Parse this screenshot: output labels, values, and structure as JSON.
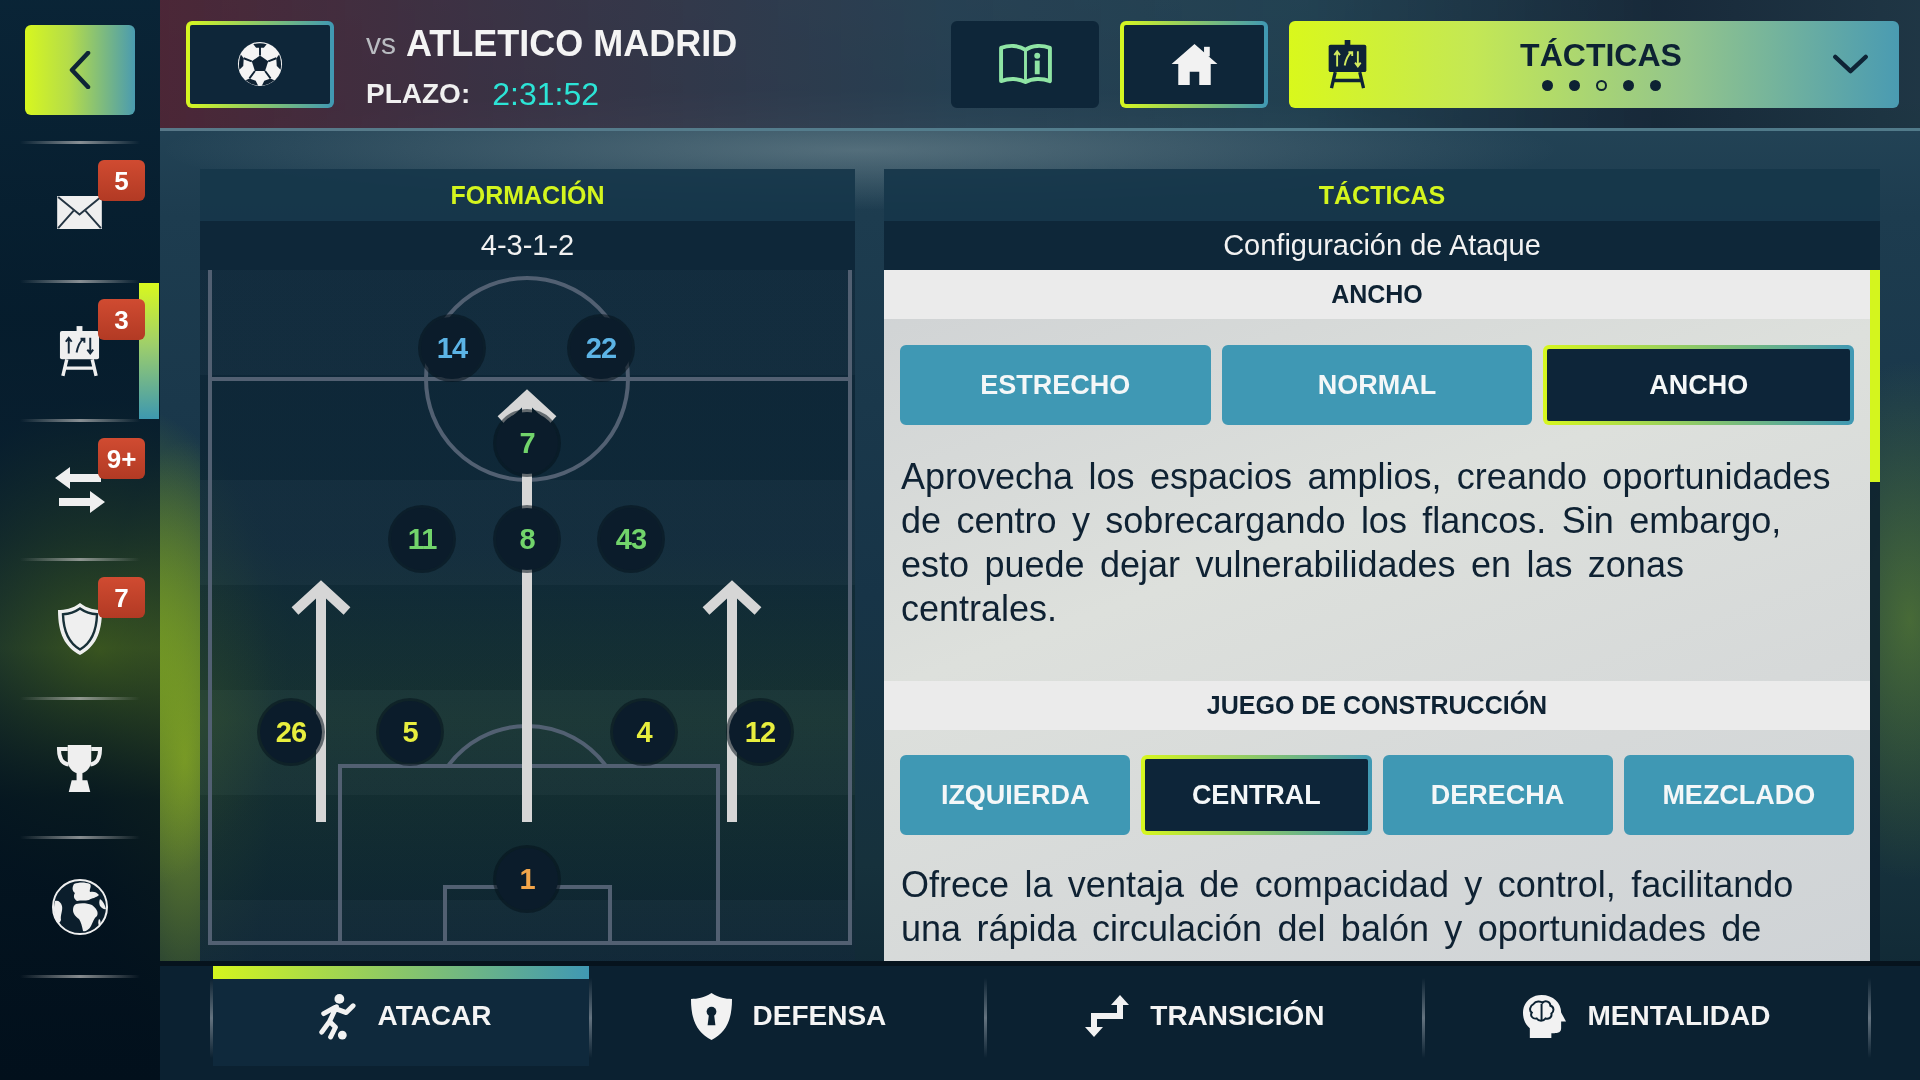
{
  "sidebar": {
    "items": [
      {
        "badge": "5",
        "selected": false
      },
      {
        "badge": "3",
        "selected": true
      },
      {
        "badge": "9+",
        "selected": false
      },
      {
        "badge": "7",
        "selected": false
      },
      {
        "selected": false
      },
      {
        "selected": false
      }
    ]
  },
  "header": {
    "versus": "vs",
    "opponent": "ATLETICO MADRID",
    "deadline_label": "PLAZO:",
    "deadline": "2:31:52"
  },
  "screen_menu": {
    "title": "TÁCTICAS",
    "pages": [
      {
        "selected": false
      },
      {
        "selected": false
      },
      {
        "selected": true
      },
      {
        "selected": false
      },
      {
        "selected": false
      }
    ]
  },
  "formation_panel": {
    "title": "FORMACIÓN",
    "formation": "4-3-1-2",
    "lines": [
      {
        "players": [
          {
            "number": "14",
            "color": "#5cb4e6",
            "forward_run": false
          },
          {
            "number": "22",
            "color": "#5cb4e6",
            "forward_run": false
          }
        ]
      },
      {
        "players": [
          {
            "number": "7",
            "color": "#72d46b",
            "forward_run": true
          }
        ]
      },
      {
        "players": [
          {
            "number": "11",
            "color": "#72d46b",
            "forward_run": false
          },
          {
            "number": "8",
            "color": "#72d46b",
            "forward_run": false
          },
          {
            "number": "43",
            "color": "#72d46b",
            "forward_run": false
          }
        ]
      },
      {
        "players": [
          {
            "number": "26",
            "color": "#e8ee3e",
            "forward_run": true
          },
          {
            "number": "5",
            "color": "#e8ee3e",
            "forward_run": false
          },
          {
            "number": "4",
            "color": "#e8ee3e",
            "forward_run": false
          },
          {
            "number": "12",
            "color": "#e8ee3e",
            "forward_run": true
          }
        ]
      },
      {
        "players": [
          {
            "number": "1",
            "color": "#f2a54a",
            "forward_run": false
          }
        ]
      }
    ]
  },
  "tactics_panel": {
    "title": "TÁCTICAS",
    "subtitle": "Configuración de Ataque",
    "sections": [
      {
        "title": "ANCHO",
        "options": [
          {
            "label": "ESTRECHO",
            "selected": false
          },
          {
            "label": "NORMAL",
            "selected": false
          },
          {
            "label": "ANCHO",
            "selected": true
          }
        ],
        "description": "Aprovecha los espacios amplios, creando oportunidades de centro y sobrecargando los flancos. Sin embargo, esto puede dejar vulnerabilidades en las zonas centrales."
      },
      {
        "title": "JUEGO DE CONSTRUCCIÓN",
        "options": [
          {
            "label": "IZQUIERDA",
            "selected": false
          },
          {
            "label": "CENTRAL",
            "selected": true
          },
          {
            "label": "DERECHA",
            "selected": false
          },
          {
            "label": "MEZCLADO",
            "selected": false
          }
        ],
        "description": "Ofrece la ventaja de compacidad y control, facilitando una rápida circulación del balón y oportunidades de"
      }
    ]
  },
  "bottom_tabs": [
    {
      "label": "ATACAR",
      "selected": true
    },
    {
      "label": "DEFENSA",
      "selected": false
    },
    {
      "label": "TRANSICIÓN",
      "selected": false
    },
    {
      "label": "MENTALIDAD",
      "selected": false
    }
  ]
}
